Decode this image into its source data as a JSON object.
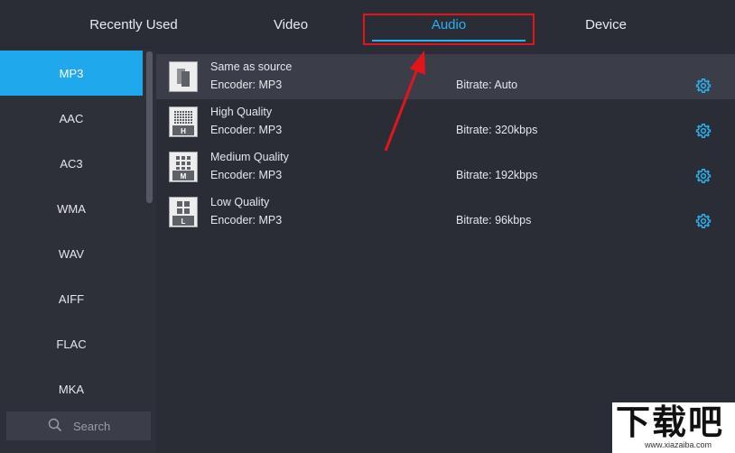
{
  "tabs": [
    {
      "label": "Recently Used",
      "active": false
    },
    {
      "label": "Video",
      "active": false
    },
    {
      "label": "Audio",
      "active": true
    },
    {
      "label": "Device",
      "active": false
    }
  ],
  "formats": [
    "MP3",
    "AAC",
    "AC3",
    "WMA",
    "WAV",
    "AIFF",
    "FLAC",
    "MKA"
  ],
  "selected_format": "MP3",
  "search": {
    "placeholder": "Search"
  },
  "presets": [
    {
      "name": "Same as source",
      "encoder": "Encoder: MP3",
      "bitrate": "Bitrate: Auto",
      "badge": "",
      "icon": "same-as-source-icon"
    },
    {
      "name": "High Quality",
      "encoder": "Encoder: MP3",
      "bitrate": "Bitrate: 320kbps",
      "badge": "H",
      "icon": "high-quality-icon"
    },
    {
      "name": "Medium Quality",
      "encoder": "Encoder: MP3",
      "bitrate": "Bitrate: 192kbps",
      "badge": "M",
      "icon": "medium-quality-icon"
    },
    {
      "name": "Low Quality",
      "encoder": "Encoder: MP3",
      "bitrate": "Bitrate: 96kbps",
      "badge": "L",
      "icon": "low-quality-icon"
    }
  ],
  "watermark": {
    "text": "下载吧",
    "sub": "www.xiazaiba.com"
  },
  "colors": {
    "accent": "#2bb1ee",
    "selected_format_bg": "#1fa8ec",
    "annotation_red": "#e4141b",
    "background": "#2a2c36",
    "sidebar": "#2e3039",
    "selected_preset_bg": "#3b3e49"
  }
}
